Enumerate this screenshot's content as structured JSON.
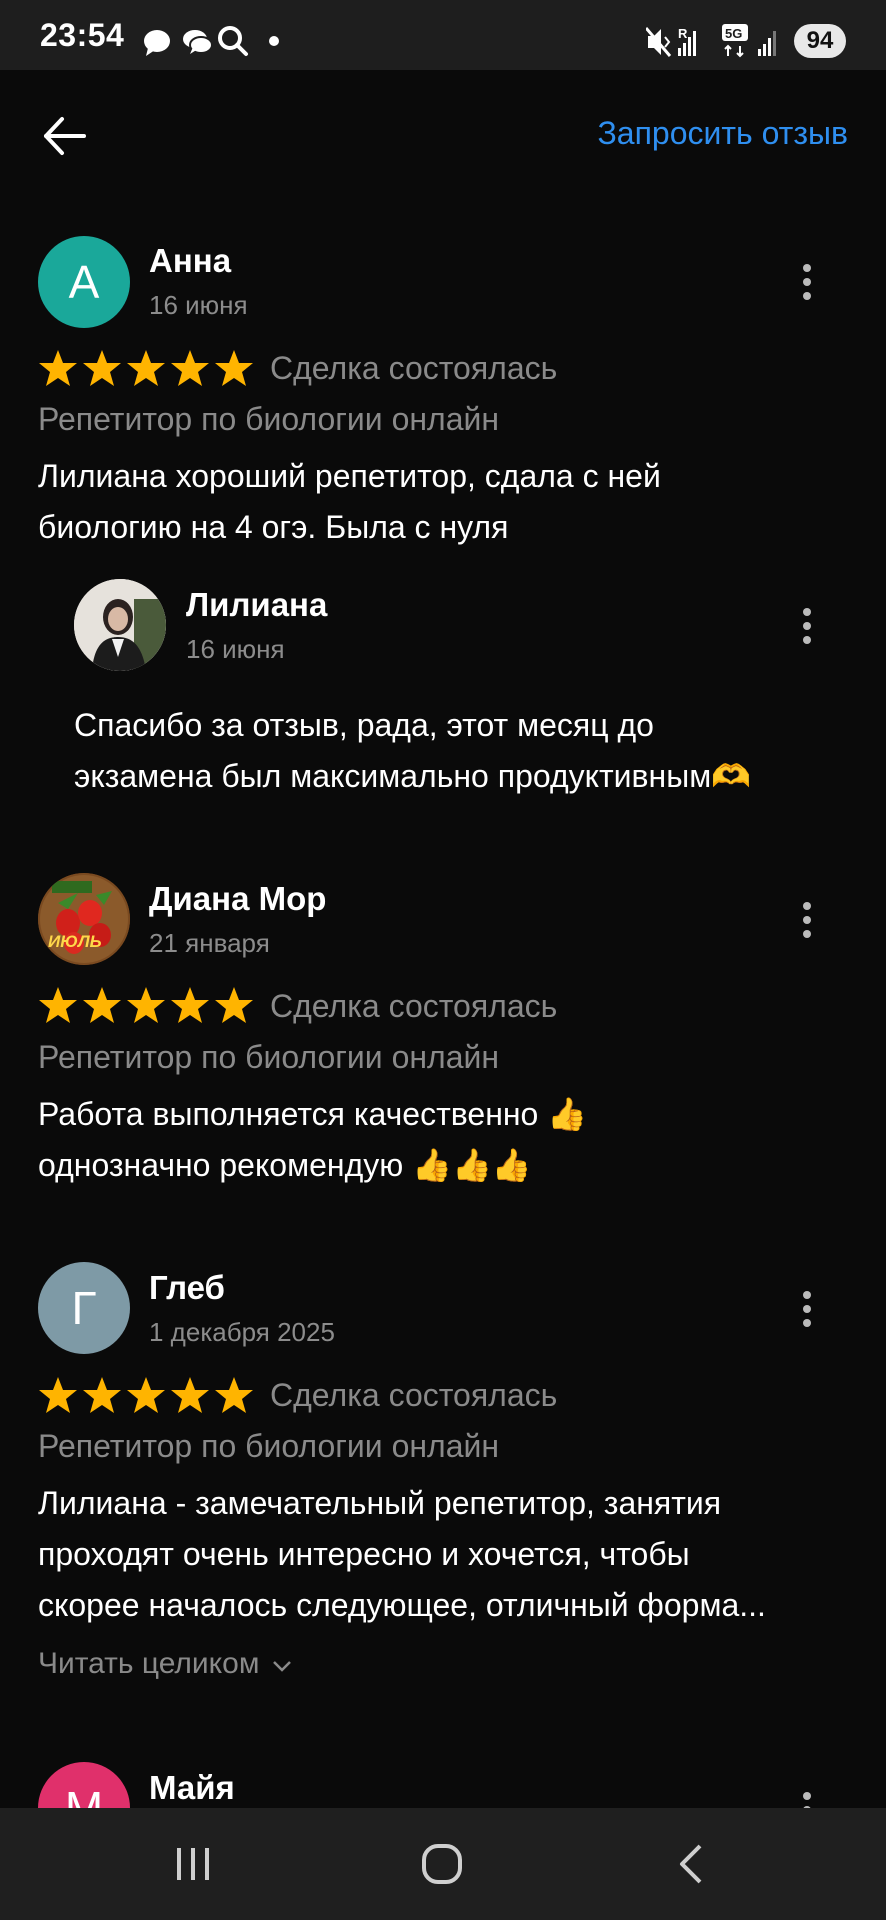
{
  "status_bar": {
    "time": "23:54",
    "left_icons": [
      "chat-bubble-icon",
      "chat-bubbles-icon",
      "search-icon",
      "dot-icon"
    ],
    "right_icons": [
      "mute-icon",
      "signal-r-icon",
      "5g-icon",
      "signal-icon"
    ],
    "network": "5G",
    "battery": "94"
  },
  "header": {
    "back_icon": "arrow-left-icon",
    "request_review": "Запросить отзыв"
  },
  "colors": {
    "accent": "#2f8ff0",
    "star": "#ffb400",
    "background": "#0a0a0a",
    "muted": "#8a8a8a"
  },
  "reviews": [
    {
      "name": "Анна",
      "initial": "А",
      "avatar_color": "#1aa89a",
      "date": "16 июня",
      "rating": 5,
      "deal": "Сделка состоялась",
      "service": "Репетитор по биологии онлайн",
      "text_lines": [
        "Лилиана хороший репетитор, сдала с ней",
        "биологию на 4 огэ. Была с нуля"
      ],
      "reply": {
        "name": "Лилиана",
        "date": "16 июня",
        "text_lines": [
          "Спасибо за отзыв, рада, этот месяц до",
          "экзамена был максимально продуктивным🫶"
        ]
      }
    },
    {
      "name": "Диана Мор",
      "avatar_text": "ИЮЛЬ",
      "date": "21 января",
      "rating": 5,
      "deal": "Сделка состоялась",
      "service": "Репетитор по биологии онлайн",
      "text_lines": [
        "Работа выполняется качественно 👍",
        "однозначно рекомендую 👍👍👍"
      ]
    },
    {
      "name": "Глеб",
      "initial": "Г",
      "avatar_color": "#7e9aa6",
      "date": "1 декабря 2025",
      "rating": 5,
      "deal": "Сделка состоялась",
      "service": "Репетитор по биологии онлайн",
      "text_lines": [
        "Лилиана - замечательный  репетитор, занятия",
        "проходят очень интересно и хочется, чтобы",
        "скорее началось следующее, отличный форма..."
      ],
      "read_more": "Читать целиком"
    },
    {
      "name": "Майя",
      "initial": "М",
      "avatar_color": "#e0306b"
    }
  ],
  "nav_bar": {
    "recents_icon": "recents-icon",
    "home_icon": "home-icon",
    "back_icon": "back-chevron-icon"
  }
}
